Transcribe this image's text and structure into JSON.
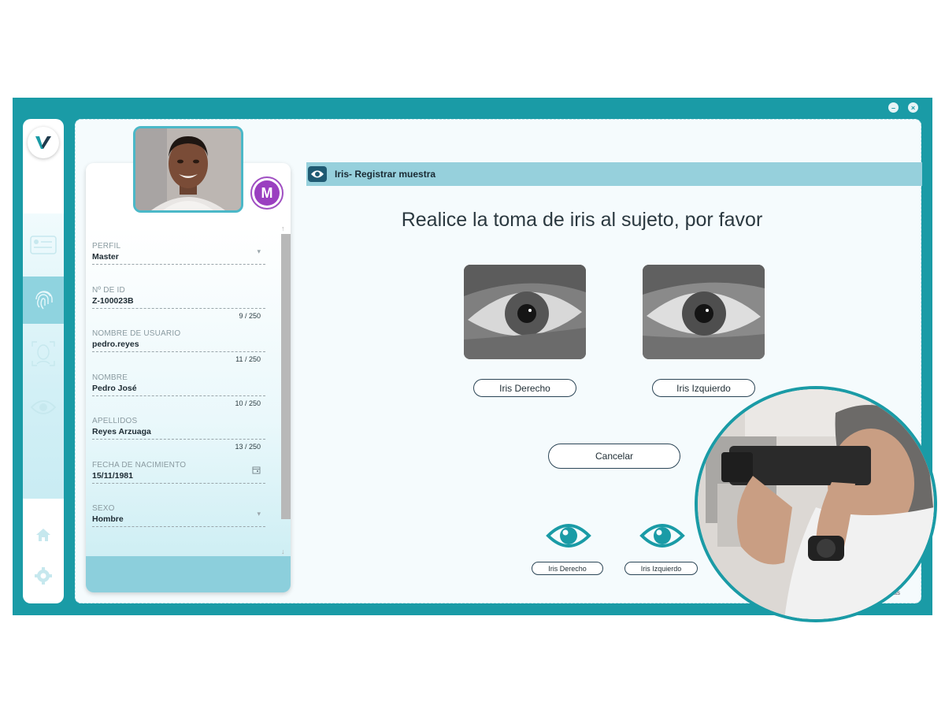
{
  "window": {
    "minimize_icon": "minimize-icon",
    "close_icon": "close-icon"
  },
  "rail": {
    "logo_letter": "V",
    "items": [
      {
        "icon": "id-card-icon"
      },
      {
        "icon": "fingerprint-icon",
        "active": true
      },
      {
        "icon": "face-scan-icon"
      },
      {
        "icon": "eye-icon"
      },
      {
        "icon": "home-icon"
      },
      {
        "icon": "settings-icon"
      }
    ]
  },
  "profile": {
    "badge": "M",
    "fields": [
      {
        "label": "PERFIL",
        "value": "Master",
        "type": "select"
      },
      {
        "label": "Nº DE ID",
        "value": "Z-100023B",
        "count": "9 / 250"
      },
      {
        "label": "NOMBRE DE USUARIO",
        "value": "pedro.reyes",
        "count": "11 / 250"
      },
      {
        "label": "NOMBRE",
        "value": "Pedro José",
        "count": "10 / 250"
      },
      {
        "label": "APELLIDOS",
        "value": "Reyes Arzuaga",
        "count": "13 / 250"
      },
      {
        "label": "FECHA DE NACIMIENTO",
        "value": "15/11/1981",
        "type": "date"
      },
      {
        "label": "SEXO",
        "value": "Hombre",
        "type": "select"
      }
    ]
  },
  "iris": {
    "section_title": "Iris- Registrar muestra",
    "heading": "Realice la toma de iris al sujeto, por favor",
    "right_button": "Iris Derecho",
    "left_button": "Iris Izquierdo",
    "cancel_button": "Cancelar",
    "bottom_right_label": "Iris Derecho",
    "bottom_left_label": "Iris Izquierdo",
    "brand": "veridas"
  },
  "colors": {
    "frame": "#1a9ba6",
    "header": "#96d0dc",
    "badge": "#9a3fc0",
    "eye_icon": "#1a9ba6"
  }
}
